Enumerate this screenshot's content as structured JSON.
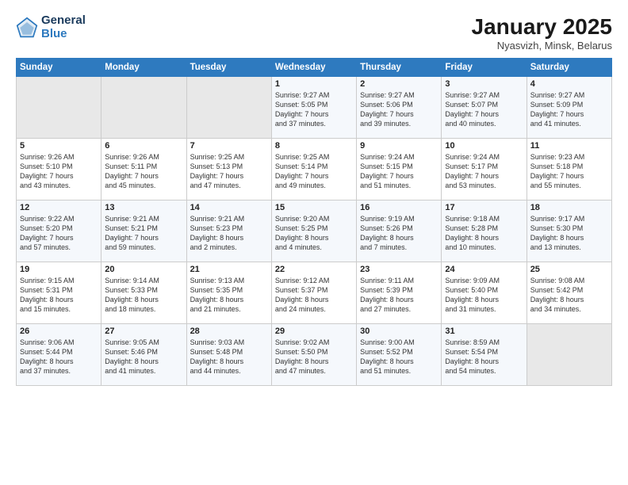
{
  "header": {
    "logo_general": "General",
    "logo_blue": "Blue",
    "month": "January 2025",
    "location": "Nyasvizh, Minsk, Belarus"
  },
  "days_of_week": [
    "Sunday",
    "Monday",
    "Tuesday",
    "Wednesday",
    "Thursday",
    "Friday",
    "Saturday"
  ],
  "weeks": [
    [
      {
        "day": "",
        "info": ""
      },
      {
        "day": "",
        "info": ""
      },
      {
        "day": "",
        "info": ""
      },
      {
        "day": "1",
        "info": "Sunrise: 9:27 AM\nSunset: 5:05 PM\nDaylight: 7 hours\nand 37 minutes."
      },
      {
        "day": "2",
        "info": "Sunrise: 9:27 AM\nSunset: 5:06 PM\nDaylight: 7 hours\nand 39 minutes."
      },
      {
        "day": "3",
        "info": "Sunrise: 9:27 AM\nSunset: 5:07 PM\nDaylight: 7 hours\nand 40 minutes."
      },
      {
        "day": "4",
        "info": "Sunrise: 9:27 AM\nSunset: 5:09 PM\nDaylight: 7 hours\nand 41 minutes."
      }
    ],
    [
      {
        "day": "5",
        "info": "Sunrise: 9:26 AM\nSunset: 5:10 PM\nDaylight: 7 hours\nand 43 minutes."
      },
      {
        "day": "6",
        "info": "Sunrise: 9:26 AM\nSunset: 5:11 PM\nDaylight: 7 hours\nand 45 minutes."
      },
      {
        "day": "7",
        "info": "Sunrise: 9:25 AM\nSunset: 5:13 PM\nDaylight: 7 hours\nand 47 minutes."
      },
      {
        "day": "8",
        "info": "Sunrise: 9:25 AM\nSunset: 5:14 PM\nDaylight: 7 hours\nand 49 minutes."
      },
      {
        "day": "9",
        "info": "Sunrise: 9:24 AM\nSunset: 5:15 PM\nDaylight: 7 hours\nand 51 minutes."
      },
      {
        "day": "10",
        "info": "Sunrise: 9:24 AM\nSunset: 5:17 PM\nDaylight: 7 hours\nand 53 minutes."
      },
      {
        "day": "11",
        "info": "Sunrise: 9:23 AM\nSunset: 5:18 PM\nDaylight: 7 hours\nand 55 minutes."
      }
    ],
    [
      {
        "day": "12",
        "info": "Sunrise: 9:22 AM\nSunset: 5:20 PM\nDaylight: 7 hours\nand 57 minutes."
      },
      {
        "day": "13",
        "info": "Sunrise: 9:21 AM\nSunset: 5:21 PM\nDaylight: 7 hours\nand 59 minutes."
      },
      {
        "day": "14",
        "info": "Sunrise: 9:21 AM\nSunset: 5:23 PM\nDaylight: 8 hours\nand 2 minutes."
      },
      {
        "day": "15",
        "info": "Sunrise: 9:20 AM\nSunset: 5:25 PM\nDaylight: 8 hours\nand 4 minutes."
      },
      {
        "day": "16",
        "info": "Sunrise: 9:19 AM\nSunset: 5:26 PM\nDaylight: 8 hours\nand 7 minutes."
      },
      {
        "day": "17",
        "info": "Sunrise: 9:18 AM\nSunset: 5:28 PM\nDaylight: 8 hours\nand 10 minutes."
      },
      {
        "day": "18",
        "info": "Sunrise: 9:17 AM\nSunset: 5:30 PM\nDaylight: 8 hours\nand 13 minutes."
      }
    ],
    [
      {
        "day": "19",
        "info": "Sunrise: 9:15 AM\nSunset: 5:31 PM\nDaylight: 8 hours\nand 15 minutes."
      },
      {
        "day": "20",
        "info": "Sunrise: 9:14 AM\nSunset: 5:33 PM\nDaylight: 8 hours\nand 18 minutes."
      },
      {
        "day": "21",
        "info": "Sunrise: 9:13 AM\nSunset: 5:35 PM\nDaylight: 8 hours\nand 21 minutes."
      },
      {
        "day": "22",
        "info": "Sunrise: 9:12 AM\nSunset: 5:37 PM\nDaylight: 8 hours\nand 24 minutes."
      },
      {
        "day": "23",
        "info": "Sunrise: 9:11 AM\nSunset: 5:39 PM\nDaylight: 8 hours\nand 27 minutes."
      },
      {
        "day": "24",
        "info": "Sunrise: 9:09 AM\nSunset: 5:40 PM\nDaylight: 8 hours\nand 31 minutes."
      },
      {
        "day": "25",
        "info": "Sunrise: 9:08 AM\nSunset: 5:42 PM\nDaylight: 8 hours\nand 34 minutes."
      }
    ],
    [
      {
        "day": "26",
        "info": "Sunrise: 9:06 AM\nSunset: 5:44 PM\nDaylight: 8 hours\nand 37 minutes."
      },
      {
        "day": "27",
        "info": "Sunrise: 9:05 AM\nSunset: 5:46 PM\nDaylight: 8 hours\nand 41 minutes."
      },
      {
        "day": "28",
        "info": "Sunrise: 9:03 AM\nSunset: 5:48 PM\nDaylight: 8 hours\nand 44 minutes."
      },
      {
        "day": "29",
        "info": "Sunrise: 9:02 AM\nSunset: 5:50 PM\nDaylight: 8 hours\nand 47 minutes."
      },
      {
        "day": "30",
        "info": "Sunrise: 9:00 AM\nSunset: 5:52 PM\nDaylight: 8 hours\nand 51 minutes."
      },
      {
        "day": "31",
        "info": "Sunrise: 8:59 AM\nSunset: 5:54 PM\nDaylight: 8 hours\nand 54 minutes."
      },
      {
        "day": "",
        "info": ""
      }
    ]
  ]
}
